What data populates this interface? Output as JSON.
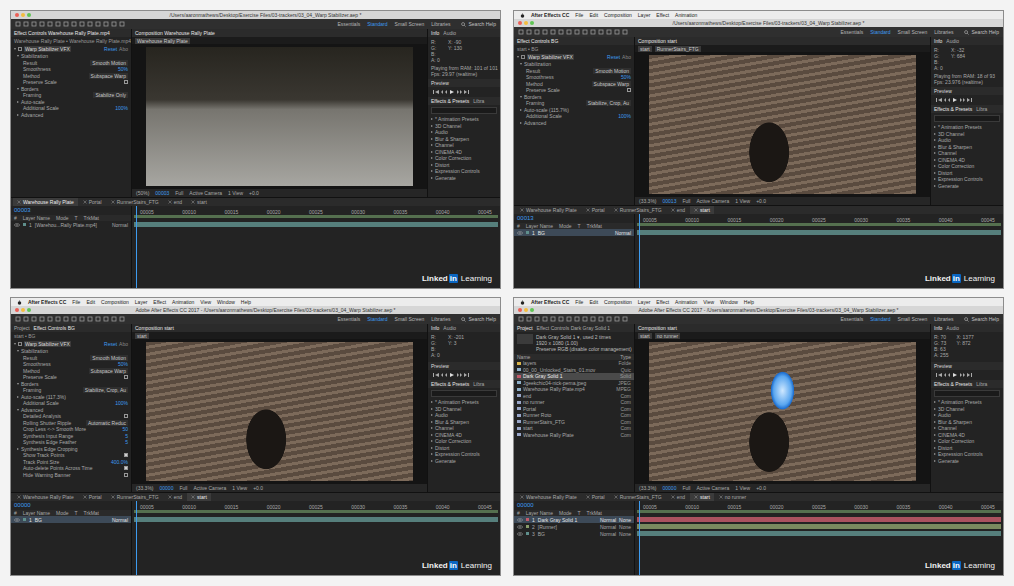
{
  "workspaces": [
    {
      "label": "Essentials",
      "selected": false
    },
    {
      "label": "Standard",
      "selected": true
    },
    {
      "label": "Small Screen",
      "selected": false
    },
    {
      "label": "Libraries",
      "selected": false
    }
  ],
  "search": "Search Help",
  "infoTabs": [
    "Info",
    "Audio"
  ],
  "preview": "Preview",
  "effectsTabs": [
    "Effects & Presets",
    "Libra"
  ],
  "effectsList": [
    "* Animation Presets",
    "3D Channel",
    "Audio",
    "Blur & Sharpen",
    "Channel",
    "CINEMA 4D",
    "Color Correction",
    "Distort",
    "Expression Controls",
    "Generate"
  ],
  "layerColumns": [
    "#",
    "Layer Name",
    "Mode",
    "T",
    "TrkMat"
  ],
  "ruler": [
    "00005",
    "00010",
    "00015",
    "00020",
    "00025",
    "00030",
    "00035",
    "00040",
    "00045"
  ],
  "watermark": {
    "brand": "Linked",
    "badge": "in",
    "product": "Learning"
  },
  "panels": [
    {
      "app": "",
      "menu": [],
      "title": "/Users/aaronmathews/Desktop/Exercise Files/03-trackers/03_04_Warp Stabilizer.aep *",
      "left": {
        "kind": "effects",
        "tabs": [
          {
            "label": "Effect Controls Warehouse Rally Plate.mp4",
            "selected": true
          }
        ],
        "crumb": "Warehouse Rally Plate • Warehouse Rally Plate.mp4",
        "effect": "Warp Stabilizer VFX",
        "reset": "Reset",
        "about": "Abo",
        "props": [
          {
            "kind": "group",
            "label": "Stabilization",
            "expanded": true
          },
          {
            "kind": "select",
            "label": "Result",
            "value": "Smooth Motion"
          },
          {
            "kind": "value",
            "label": "Smoothness",
            "value": "50%"
          },
          {
            "kind": "select",
            "label": "Method",
            "value": "Subspace Warp"
          },
          {
            "kind": "check",
            "label": "Preserve Scale",
            "checked": false
          },
          {
            "kind": "group",
            "label": "Borders",
            "expanded": true
          },
          {
            "kind": "select",
            "label": "Framing",
            "value": "Stabilize Only"
          },
          {
            "kind": "group",
            "label": "Auto-scale",
            "expanded": false
          },
          {
            "kind": "value",
            "label": "Additional Scale",
            "value": "100%"
          },
          {
            "kind": "group",
            "label": "Advanced",
            "expanded": false
          }
        ]
      },
      "viewer": {
        "tab": "Composition Warehouse Rally Plate",
        "crumbs": [
          "Warehouse Rally Plate"
        ],
        "footer": [
          "(50%)",
          "00003",
          "Full",
          "Active Camera",
          "1 View",
          "+0.0"
        ]
      },
      "right": {
        "color": [
          "R:",
          "G:",
          "B:",
          "A: 0"
        ],
        "coords": [
          "X: -90",
          "Y: 130"
        ],
        "status": [
          "Playing from RAM: 101 of 101",
          "Fps: 29.97 (realtime)"
        ]
      },
      "timeline": {
        "time": "00003",
        "tabs": [
          {
            "label": "Warehouse Rally Plate",
            "selected": true
          },
          {
            "label": "Portal",
            "selected": false
          },
          {
            "label": "RunnerStairs_FTG",
            "selected": false
          },
          {
            "label": "end",
            "selected": false
          },
          {
            "label": "start",
            "selected": false
          }
        ],
        "layers": [
          {
            "num": "1",
            "name": "[Warehou...Rally Plate.mp4]",
            "mode": "Normal",
            "trk": "",
            "selected": false,
            "color": "#5f8f8c"
          }
        ]
      }
    },
    {
      "app": "After Effects CC",
      "menu": [
        "File",
        "Edit",
        "Composition",
        "Layer",
        "Effect",
        "Animation"
      ],
      "title": "/Users/aaronmathews/Desktop/Exercise Files/03-trackers/03_04_Warp Stabilizer.aep *",
      "left": {
        "kind": "effects",
        "tabs": [
          {
            "label": "Effect Controls BG",
            "selected": true
          }
        ],
        "crumb": "start • BG",
        "effect": "Warp Stabilizer VFX",
        "reset": "Reset",
        "about": "Abo",
        "props": [
          {
            "kind": "group",
            "label": "Stabilization",
            "expanded": true
          },
          {
            "kind": "select",
            "label": "Result",
            "value": "Smooth Motion"
          },
          {
            "kind": "value",
            "label": "Smoothness",
            "value": "50%"
          },
          {
            "kind": "select",
            "label": "Method",
            "value": "Subspace Warp"
          },
          {
            "kind": "check",
            "label": "Preserve Scale",
            "checked": false
          },
          {
            "kind": "group",
            "label": "Borders",
            "expanded": true
          },
          {
            "kind": "select",
            "label": "Framing",
            "value": "Stabilize, Crop, Au"
          },
          {
            "kind": "group",
            "label": "Auto-scale (115.7%)",
            "expanded": false
          },
          {
            "kind": "value",
            "label": "Additional Scale",
            "value": "100%"
          },
          {
            "kind": "group",
            "label": "Advanced",
            "expanded": false
          }
        ]
      },
      "viewer": {
        "tab": "Composition start",
        "crumbs": [
          "start",
          "RunnerStairs_FTG"
        ],
        "footer": [
          "(33.3%)",
          "00013",
          "Full",
          "Active Camera",
          "1 View",
          "+0.0"
        ]
      },
      "right": {
        "color": [
          "R:",
          "G:",
          "B:",
          "A: 0"
        ],
        "coords": [
          "X: -32",
          "Y: 684"
        ],
        "status": [
          "Playing from RAM: 18 of 93",
          "Fps: 23.976 (realtime)"
        ]
      },
      "timeline": {
        "time": "00013",
        "tabs": [
          {
            "label": "Warehouse Rally Plate",
            "selected": false
          },
          {
            "label": "Portal",
            "selected": false
          },
          {
            "label": "RunnerStairs_FTG",
            "selected": false
          },
          {
            "label": "end",
            "selected": false
          },
          {
            "label": "start",
            "selected": true
          }
        ],
        "layers": [
          {
            "num": "1",
            "name": "BG",
            "mode": "Normal",
            "trk": "",
            "selected": true,
            "color": "#5f8f8c"
          }
        ]
      }
    },
    {
      "app": "After Effects CC",
      "menu": [
        "File",
        "Edit",
        "Composition",
        "Layer",
        "Effect",
        "Animation",
        "View",
        "Window",
        "Help"
      ],
      "title": "Adobe After Effects CC 2017 - /Users/aaronmathews/Desktop/Exercise Files/03-trackers/03_04_Warp Stabilizer.aep *",
      "left": {
        "kind": "effects",
        "tabs": [
          {
            "label": "Project",
            "selected": false
          },
          {
            "label": "Effect Controls BG",
            "selected": true
          }
        ],
        "crumb": "start • BG",
        "effect": "Warp Stabilizer VFX",
        "reset": "Reset",
        "about": "Abo",
        "props": [
          {
            "kind": "group",
            "label": "Stabilization",
            "expanded": true
          },
          {
            "kind": "select",
            "label": "Result",
            "value": "Smooth Motion"
          },
          {
            "kind": "value",
            "label": "Smoothness",
            "value": "50%"
          },
          {
            "kind": "select",
            "label": "Method",
            "value": "Subspace Warp"
          },
          {
            "kind": "check",
            "label": "Preserve Scale",
            "checked": false
          },
          {
            "kind": "group",
            "label": "Borders",
            "expanded": true
          },
          {
            "kind": "select",
            "label": "Framing",
            "value": "Stabilize, Crop, Au"
          },
          {
            "kind": "group",
            "label": "Auto-scale (117.3%)",
            "expanded": false
          },
          {
            "kind": "value",
            "label": "Additional Scale",
            "value": "100%"
          },
          {
            "kind": "group",
            "label": "Advanced",
            "expanded": true
          },
          {
            "kind": "check",
            "label": "Detailed Analysis",
            "checked": false
          },
          {
            "kind": "select",
            "label": "Rolling Shutter Ripple",
            "value": "Automatic Reduc"
          },
          {
            "kind": "value",
            "label": "Crop Less <-> Smooth More",
            "value": "50"
          },
          {
            "kind": "value",
            "label": "Synthesis Input Range",
            "value": "5"
          },
          {
            "kind": "value",
            "label": "Synthesis Edge Feather",
            "value": "5"
          },
          {
            "kind": "group",
            "label": "Synthesis Edge Cropping",
            "expanded": false
          },
          {
            "kind": "check",
            "label": "Show Track Points",
            "checked": true
          },
          {
            "kind": "value",
            "label": "Track Point Size",
            "value": "400.0%"
          },
          {
            "kind": "check",
            "label": "Auto-delete Points Across Time",
            "checked": true
          },
          {
            "kind": "check",
            "label": "Hide Warning Banner",
            "checked": false
          }
        ]
      },
      "viewer": {
        "tab": "Composition start",
        "crumbs": [
          "start"
        ],
        "footer": [
          "(33.3%)",
          "00000",
          "Full",
          "Active Camera",
          "1 View",
          "+0.0"
        ]
      },
      "right": {
        "color": [
          "R:",
          "G:",
          "B:",
          "A: 0"
        ],
        "coords": [
          "X: -201",
          "Y: 3"
        ],
        "status": []
      },
      "timeline": {
        "time": "00000",
        "tabs": [
          {
            "label": "Warehouse Rally Plate",
            "selected": false
          },
          {
            "label": "Portal",
            "selected": false
          },
          {
            "label": "RunnerStairs_FTG",
            "selected": false
          },
          {
            "label": "end",
            "selected": false
          },
          {
            "label": "start",
            "selected": true
          }
        ],
        "layers": [
          {
            "num": "1",
            "name": "BG",
            "mode": "Normal",
            "trk": "",
            "selected": true,
            "color": "#5f8f8c"
          }
        ]
      }
    },
    {
      "app": "After Effects CC",
      "menu": [
        "File",
        "Edit",
        "Composition",
        "Layer",
        "Effect",
        "Animation",
        "View",
        "Window",
        "Help"
      ],
      "title": "Adobe After Effects CC 2017 - /Users/aaronmathews/Desktop/Exercise Files/03-trackers/03_04_Warp Stabilizer.aep *",
      "left": {
        "kind": "project",
        "tabs": [
          {
            "label": "Project",
            "selected": true
          },
          {
            "label": "Effect Controls Dark Gray Solid 1",
            "selected": false
          }
        ],
        "info": [
          "Dark Gray Solid 1 ▾, used 2 times",
          "1920 x 1080 (1.00)",
          "Preserve RGB (disable color management)"
        ],
        "columns": [
          "Name",
          "Type"
        ],
        "items": [
          {
            "name": "layers",
            "type": "Folde",
            "selected": false,
            "color": "#d9b44a"
          },
          {
            "name": "00_00_Unlocked_Stairs_01.mov",
            "type": "Quic",
            "selected": false,
            "color": "#8fb0c9"
          },
          {
            "name": "Dark Gray Solid 1",
            "type": "Solid",
            "selected": true,
            "color": "#c25a6a"
          },
          {
            "name": "Jgeekchic04-nick-pema.jpeg",
            "type": "JPEG",
            "selected": false,
            "color": "#8fb0c9"
          },
          {
            "name": "Warehouse Rally Plate.mp4",
            "type": "MPEG",
            "selected": false,
            "color": "#8fb0c9"
          },
          {
            "name": "end",
            "type": "Com",
            "selected": false,
            "color": "#9aa7c9"
          },
          {
            "name": "no runner",
            "type": "Com",
            "selected": false,
            "color": "#9aa7c9"
          },
          {
            "name": "Portal",
            "type": "Com",
            "selected": false,
            "color": "#9aa7c9"
          },
          {
            "name": "Runner Roto",
            "type": "Com",
            "selected": false,
            "color": "#9aa7c9"
          },
          {
            "name": "RunnerStairs_FTG",
            "type": "Com",
            "selected": false,
            "color": "#9aa7c9"
          },
          {
            "name": "start",
            "type": "Com",
            "selected": false,
            "color": "#9aa7c9"
          },
          {
            "name": "Warehouse Rally Plate",
            "type": "Com",
            "selected": false,
            "color": "#9aa7c9"
          }
        ]
      },
      "viewer": {
        "tab": "Composition start",
        "crumbs": [
          "start",
          "no runner"
        ],
        "footer": [
          "(33.3%)",
          "00000",
          "Full",
          "Active Camera",
          "1 View",
          "+0.0"
        ]
      },
      "right": {
        "color": [
          "R: 70",
          "G: 73",
          "B: 63",
          "A: 255"
        ],
        "coords": [
          "X: 1377",
          "Y: 872"
        ],
        "status": []
      },
      "timeline": {
        "time": "00000",
        "tabs": [
          {
            "label": "Warehouse Rally Plate",
            "selected": false
          },
          {
            "label": "Portal",
            "selected": false
          },
          {
            "label": "RunnerStairs_FTG",
            "selected": false
          },
          {
            "label": "end",
            "selected": false
          },
          {
            "label": "start",
            "selected": true
          },
          {
            "label": "no runner",
            "selected": false
          }
        ],
        "layers": [
          {
            "num": "1",
            "name": "Dark Gray Solid 1",
            "mode": "Normal",
            "trk": "None",
            "selected": true,
            "color": "#c25a6a"
          },
          {
            "num": "2",
            "name": "[Runner]",
            "mode": "Normal",
            "trk": "None",
            "selected": false,
            "color": "#8a9c6a"
          },
          {
            "num": "3",
            "name": "BG",
            "mode": "Normal",
            "trk": "None",
            "selected": false,
            "color": "#5f8f8c"
          }
        ]
      }
    }
  ]
}
